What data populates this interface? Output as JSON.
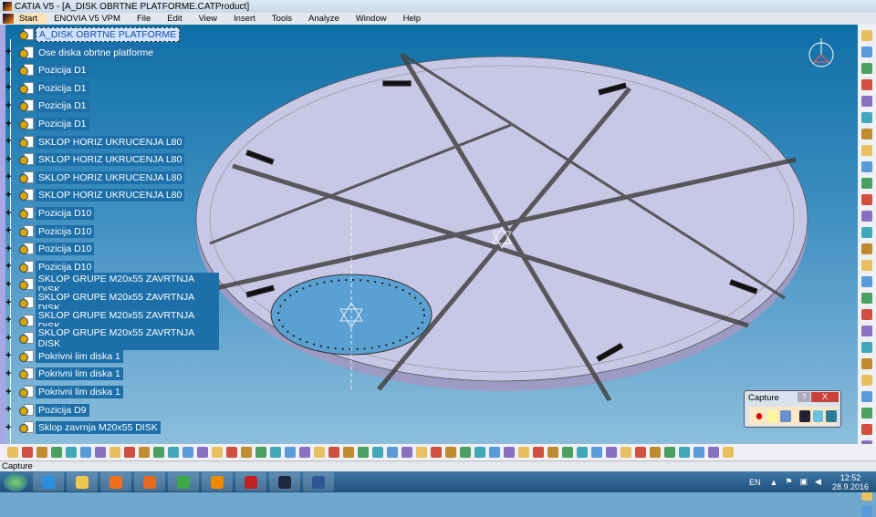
{
  "window": {
    "title": "CATIA V5 - [A_DISK OBRTNE PLATFORME.CATProduct]"
  },
  "menu": [
    "Start",
    "ENOVIA V5 VPM",
    "File",
    "Edit",
    "View",
    "Insert",
    "Tools",
    "Analyze",
    "Window",
    "Help"
  ],
  "tree": {
    "items": [
      {
        "label": "A_DISK OBRTNE PLATFORME"
      },
      {
        "label": "Ose diska obrtne platforme"
      },
      {
        "label": "Pozicija D1"
      },
      {
        "label": "Pozicija D1"
      },
      {
        "label": "Pozicija D1"
      },
      {
        "label": "Pozicija D1"
      },
      {
        "label": "SKLOP HORIZ UKRUCENJA L80"
      },
      {
        "label": "SKLOP HORIZ UKRUCENJA L80"
      },
      {
        "label": "SKLOP HORIZ UKRUCENJA L80"
      },
      {
        "label": "SKLOP HORIZ UKRUCENJA L80"
      },
      {
        "label": "Pozicija D10"
      },
      {
        "label": "Pozicija D10"
      },
      {
        "label": "Pozicija D10"
      },
      {
        "label": "Pozicija D10"
      },
      {
        "label": "SKLOP GRUPE M20x55 ZAVRTNJA DISK"
      },
      {
        "label": "SKLOP GRUPE M20x55 ZAVRTNJA DISK"
      },
      {
        "label": "SKLOP GRUPE M20x55 ZAVRTNJA DISK"
      },
      {
        "label": "SKLOP GRUPE M20x55 ZAVRTNJA DISK"
      },
      {
        "label": "Pokrivni lim diska 1"
      },
      {
        "label": "Pokrivni lim diska 1"
      },
      {
        "label": "Pokrivni lim diska 1"
      },
      {
        "label": "Pozicija D9"
      },
      {
        "label": "Sklop zavrnja M20x55 DISK"
      }
    ]
  },
  "capture_panel": {
    "title": "Capture",
    "help": "?",
    "close": "X"
  },
  "status": {
    "text": "Capture"
  },
  "taskbar": {
    "apps": [
      "internet-explorer",
      "file-explorer",
      "media-player",
      "firefox",
      "chrome",
      "vlc",
      "autocad",
      "app-dark",
      "word"
    ],
    "lang": "EN",
    "time": "12:52",
    "date": "28.9.2016"
  },
  "colors": {
    "viewport_top": "#0e6fa6",
    "viewport_bottom": "#8dbedc",
    "tree_highlight": "#1c6fa8",
    "disk": "#c9c7e6"
  }
}
